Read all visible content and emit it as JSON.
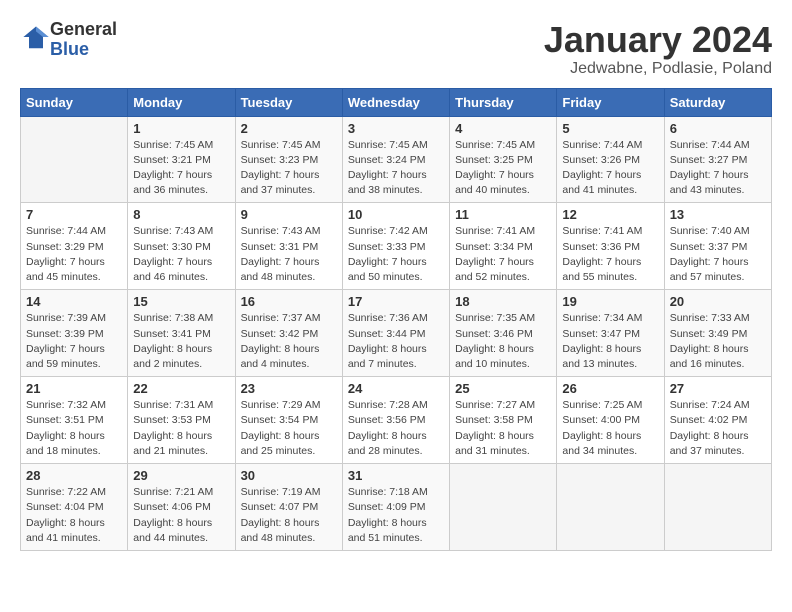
{
  "header": {
    "logo_text_general": "General",
    "logo_text_blue": "Blue",
    "month": "January 2024",
    "location": "Jedwabne, Podlasie, Poland"
  },
  "days_of_week": [
    "Sunday",
    "Monday",
    "Tuesday",
    "Wednesday",
    "Thursday",
    "Friday",
    "Saturday"
  ],
  "weeks": [
    [
      {
        "day": "",
        "info": ""
      },
      {
        "day": "1",
        "info": "Sunrise: 7:45 AM\nSunset: 3:21 PM\nDaylight: 7 hours\nand 36 minutes."
      },
      {
        "day": "2",
        "info": "Sunrise: 7:45 AM\nSunset: 3:23 PM\nDaylight: 7 hours\nand 37 minutes."
      },
      {
        "day": "3",
        "info": "Sunrise: 7:45 AM\nSunset: 3:24 PM\nDaylight: 7 hours\nand 38 minutes."
      },
      {
        "day": "4",
        "info": "Sunrise: 7:45 AM\nSunset: 3:25 PM\nDaylight: 7 hours\nand 40 minutes."
      },
      {
        "day": "5",
        "info": "Sunrise: 7:44 AM\nSunset: 3:26 PM\nDaylight: 7 hours\nand 41 minutes."
      },
      {
        "day": "6",
        "info": "Sunrise: 7:44 AM\nSunset: 3:27 PM\nDaylight: 7 hours\nand 43 minutes."
      }
    ],
    [
      {
        "day": "7",
        "info": "Sunrise: 7:44 AM\nSunset: 3:29 PM\nDaylight: 7 hours\nand 45 minutes."
      },
      {
        "day": "8",
        "info": "Sunrise: 7:43 AM\nSunset: 3:30 PM\nDaylight: 7 hours\nand 46 minutes."
      },
      {
        "day": "9",
        "info": "Sunrise: 7:43 AM\nSunset: 3:31 PM\nDaylight: 7 hours\nand 48 minutes."
      },
      {
        "day": "10",
        "info": "Sunrise: 7:42 AM\nSunset: 3:33 PM\nDaylight: 7 hours\nand 50 minutes."
      },
      {
        "day": "11",
        "info": "Sunrise: 7:41 AM\nSunset: 3:34 PM\nDaylight: 7 hours\nand 52 minutes."
      },
      {
        "day": "12",
        "info": "Sunrise: 7:41 AM\nSunset: 3:36 PM\nDaylight: 7 hours\nand 55 minutes."
      },
      {
        "day": "13",
        "info": "Sunrise: 7:40 AM\nSunset: 3:37 PM\nDaylight: 7 hours\nand 57 minutes."
      }
    ],
    [
      {
        "day": "14",
        "info": "Sunrise: 7:39 AM\nSunset: 3:39 PM\nDaylight: 7 hours\nand 59 minutes."
      },
      {
        "day": "15",
        "info": "Sunrise: 7:38 AM\nSunset: 3:41 PM\nDaylight: 8 hours\nand 2 minutes."
      },
      {
        "day": "16",
        "info": "Sunrise: 7:37 AM\nSunset: 3:42 PM\nDaylight: 8 hours\nand 4 minutes."
      },
      {
        "day": "17",
        "info": "Sunrise: 7:36 AM\nSunset: 3:44 PM\nDaylight: 8 hours\nand 7 minutes."
      },
      {
        "day": "18",
        "info": "Sunrise: 7:35 AM\nSunset: 3:46 PM\nDaylight: 8 hours\nand 10 minutes."
      },
      {
        "day": "19",
        "info": "Sunrise: 7:34 AM\nSunset: 3:47 PM\nDaylight: 8 hours\nand 13 minutes."
      },
      {
        "day": "20",
        "info": "Sunrise: 7:33 AM\nSunset: 3:49 PM\nDaylight: 8 hours\nand 16 minutes."
      }
    ],
    [
      {
        "day": "21",
        "info": "Sunrise: 7:32 AM\nSunset: 3:51 PM\nDaylight: 8 hours\nand 18 minutes."
      },
      {
        "day": "22",
        "info": "Sunrise: 7:31 AM\nSunset: 3:53 PM\nDaylight: 8 hours\nand 21 minutes."
      },
      {
        "day": "23",
        "info": "Sunrise: 7:29 AM\nSunset: 3:54 PM\nDaylight: 8 hours\nand 25 minutes."
      },
      {
        "day": "24",
        "info": "Sunrise: 7:28 AM\nSunset: 3:56 PM\nDaylight: 8 hours\nand 28 minutes."
      },
      {
        "day": "25",
        "info": "Sunrise: 7:27 AM\nSunset: 3:58 PM\nDaylight: 8 hours\nand 31 minutes."
      },
      {
        "day": "26",
        "info": "Sunrise: 7:25 AM\nSunset: 4:00 PM\nDaylight: 8 hours\nand 34 minutes."
      },
      {
        "day": "27",
        "info": "Sunrise: 7:24 AM\nSunset: 4:02 PM\nDaylight: 8 hours\nand 37 minutes."
      }
    ],
    [
      {
        "day": "28",
        "info": "Sunrise: 7:22 AM\nSunset: 4:04 PM\nDaylight: 8 hours\nand 41 minutes."
      },
      {
        "day": "29",
        "info": "Sunrise: 7:21 AM\nSunset: 4:06 PM\nDaylight: 8 hours\nand 44 minutes."
      },
      {
        "day": "30",
        "info": "Sunrise: 7:19 AM\nSunset: 4:07 PM\nDaylight: 8 hours\nand 48 minutes."
      },
      {
        "day": "31",
        "info": "Sunrise: 7:18 AM\nSunset: 4:09 PM\nDaylight: 8 hours\nand 51 minutes."
      },
      {
        "day": "",
        "info": ""
      },
      {
        "day": "",
        "info": ""
      },
      {
        "day": "",
        "info": ""
      }
    ]
  ]
}
